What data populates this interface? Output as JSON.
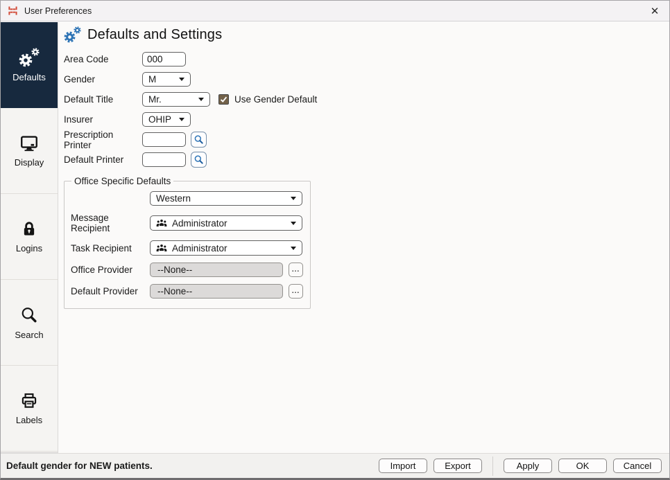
{
  "window": {
    "title": "User Preferences",
    "close_label": "✕"
  },
  "sidebar": {
    "items": [
      {
        "label": "Defaults",
        "icon": "gears-icon",
        "selected": true
      },
      {
        "label": "Display",
        "icon": "monitor-icon",
        "selected": false
      },
      {
        "label": "Logins",
        "icon": "lock-icon",
        "selected": false
      },
      {
        "label": "Search",
        "icon": "magnifier-icon",
        "selected": false
      },
      {
        "label": "Labels",
        "icon": "printer-icon",
        "selected": false
      }
    ]
  },
  "header": {
    "title": "Defaults and Settings",
    "icon": "gears-icon"
  },
  "form": {
    "area_code": {
      "label": "Area Code",
      "value": "000"
    },
    "gender": {
      "label": "Gender",
      "value": "M"
    },
    "default_title": {
      "label": "Default Title",
      "value": "Mr."
    },
    "use_gender_default": {
      "label": "Use Gender Default",
      "checked": true
    },
    "insurer": {
      "label": "Insurer",
      "value": "OHIP"
    },
    "prescription_printer": {
      "label": "Prescription Printer",
      "value": ""
    },
    "default_printer": {
      "label": "Default Printer",
      "value": ""
    }
  },
  "office_defaults": {
    "legend": "Office Specific Defaults",
    "office": {
      "label": "",
      "value": "Western"
    },
    "message_recipient": {
      "label": "Message Recipient",
      "value": "Administrator",
      "icon": "people-icon"
    },
    "task_recipient": {
      "label": "Task Recipient",
      "value": "Administrator",
      "icon": "people-icon"
    },
    "office_provider": {
      "label": "Office Provider",
      "value": "--None--",
      "browse_label": "..."
    },
    "default_provider": {
      "label": "Default Provider",
      "value": "--None--",
      "browse_label": "..."
    }
  },
  "status_bar": {
    "hint": "Default gender for NEW patients.",
    "buttons": {
      "import": "Import",
      "export": "Export",
      "apply": "Apply",
      "ok": "OK",
      "cancel": "Cancel"
    }
  },
  "colors": {
    "accent_blue": "#2e74b5",
    "selected_tab_bg": "#17293e",
    "checkbox_checked": "#73624a",
    "app_icon_red": "#d24b38",
    "disabled_field_bg": "#dcdad9"
  }
}
